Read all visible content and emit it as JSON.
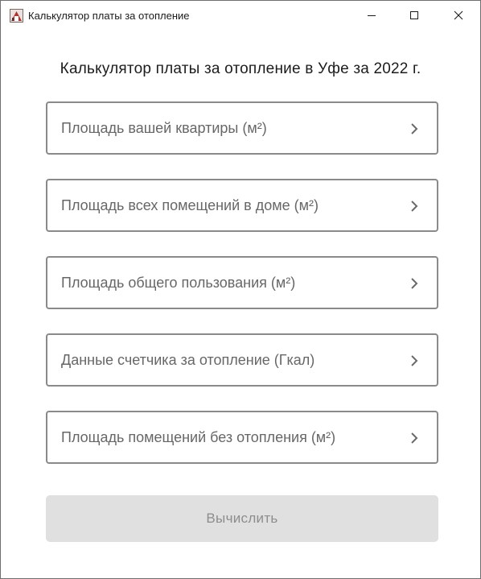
{
  "window": {
    "title": "Калькулятор платы за отопление",
    "icon": "app-icon",
    "controls": [
      "minimize-icon",
      "maximize-icon",
      "close-icon"
    ]
  },
  "heading": "Калькулятор платы за отопление в Уфе за 2022 г.",
  "fields": [
    {
      "label": "Площадь вашей квартиры (м²)",
      "icon": "chevron-right-icon"
    },
    {
      "label": "Площадь всех помещений в доме (м²)",
      "icon": "chevron-right-icon"
    },
    {
      "label": "Площадь общего пользования (м²)",
      "icon": "chevron-right-icon"
    },
    {
      "label": "Данные счетчика за отопление (Гкал)",
      "icon": "chevron-right-icon"
    },
    {
      "label": "Площадь помещений без отопления (м²)",
      "icon": "chevron-right-icon"
    }
  ],
  "calculate_button": {
    "label": "Вычислить",
    "state": "disabled"
  },
  "colors": {
    "border": "#8a8a8a",
    "label": "#676767",
    "button_bg": "#e0e0e0",
    "button_text": "#8d8d8d"
  }
}
